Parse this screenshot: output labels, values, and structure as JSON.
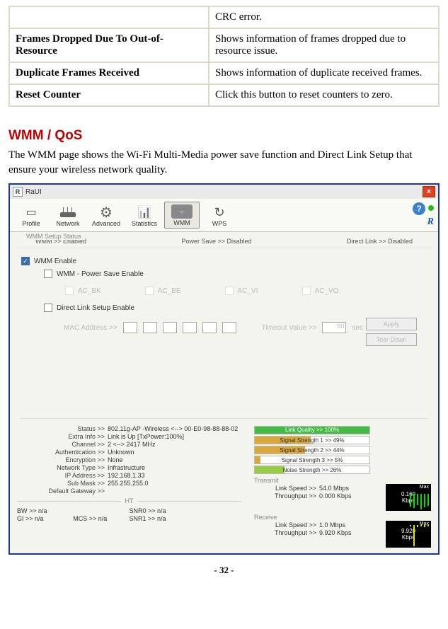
{
  "table": {
    "row0": {
      "label": "",
      "desc": "CRC error."
    },
    "row1": {
      "label": "Frames Dropped Due To Out-of-Resource",
      "desc": "Shows information of frames dropped due to resource issue."
    },
    "row2": {
      "label": "Duplicate Frames Received",
      "desc": "Shows information of duplicate received frames."
    },
    "row3": {
      "label": "Reset Counter",
      "desc": "Click this button to reset counters to zero."
    }
  },
  "heading": "WMM / QoS",
  "description": "The WMM page shows the Wi-Fi Multi-Media power save function and Direct Link Setup that ensure your wireless network quality.",
  "app": {
    "title": "RaUI",
    "toolbar": {
      "profile": "Profile",
      "network": "Network",
      "advanced": "Advanced",
      "statistics": "Statistics",
      "wmm": "WMM",
      "wps": "WPS",
      "brand": "R"
    },
    "status_row": {
      "setup_label": "WMM Setup Status",
      "wmm": "WMM >> Enabled",
      "power_save": "Power Save >> Disabled",
      "direct_link": "Direct Link >> Disabled"
    },
    "checks": {
      "wmm_enable": "WMM Enable",
      "power_save_enable": "WMM - Power Save Enable",
      "ac_bk": "AC_BK",
      "ac_be": "AC_BE",
      "ac_vi": "AC_VI",
      "ac_vo": "AC_VO",
      "direct_link": "Direct Link Setup Enable"
    },
    "mac": {
      "label": "MAC Address >>",
      "timeout_label": "Timeout Value >>",
      "timeout_value": "60",
      "timeout_unit": "sec"
    },
    "buttons": {
      "apply": "Apply",
      "teardown": "Tear Down"
    },
    "info": {
      "status_l": "Status >>",
      "status_v": "802.11g-AP -Wireless  <--> 00-E0-98-88-88-02",
      "extra_l": "Extra Info >>",
      "extra_v": "Link is Up [TxPower:100%]",
      "channel_l": "Channel >>",
      "channel_v": "2 <--> 2417 MHz",
      "auth_l": "Authentication >>",
      "auth_v": "Unknown",
      "enc_l": "Encryption >>",
      "enc_v": "None",
      "nettype_l": "Network Type >>",
      "nettype_v": "Infrastructure",
      "ip_l": "IP Address >>",
      "ip_v": "192.168.1.33",
      "mask_l": "Sub Mask >>",
      "mask_v": "255.255.255.0",
      "gw_l": "Default Gateway >>",
      "gw_v": ""
    },
    "ht": {
      "label": "HT",
      "bw_l": "BW >> n/a",
      "gi_l": "GI >> n/a",
      "mcs_l": "MCS >> n/a",
      "snr0_l": "SNR0 >> n/a",
      "snr1_l": "SNR1 >> n/a"
    },
    "bars": {
      "link": "Link Quality >> 100%",
      "sig1": "Signal Strength 1 >> 49%",
      "sig2": "Signal Strength 2 >> 44%",
      "sig3": "Signal Strength 3 >> 5%",
      "noise": "Noise Strength >> 26%"
    },
    "transmit": {
      "label": "Transmit",
      "speed_l": "Link Speed >>",
      "speed_v": "54.0 Mbps",
      "thru_l": "Throughput >>",
      "thru_v": "0.000 Kbps",
      "max": "Max",
      "max_v": "0.160",
      "max_unit": "Kbps"
    },
    "receive": {
      "label": "Receive",
      "speed_l": "Link Speed >>",
      "speed_v": "1.0 Mbps",
      "thru_l": "Throughput >>",
      "thru_v": "9.920 Kbps",
      "max": "Max",
      "max_v": "9.920",
      "max_unit": "Kbps"
    }
  },
  "page_num": "- 32 -"
}
